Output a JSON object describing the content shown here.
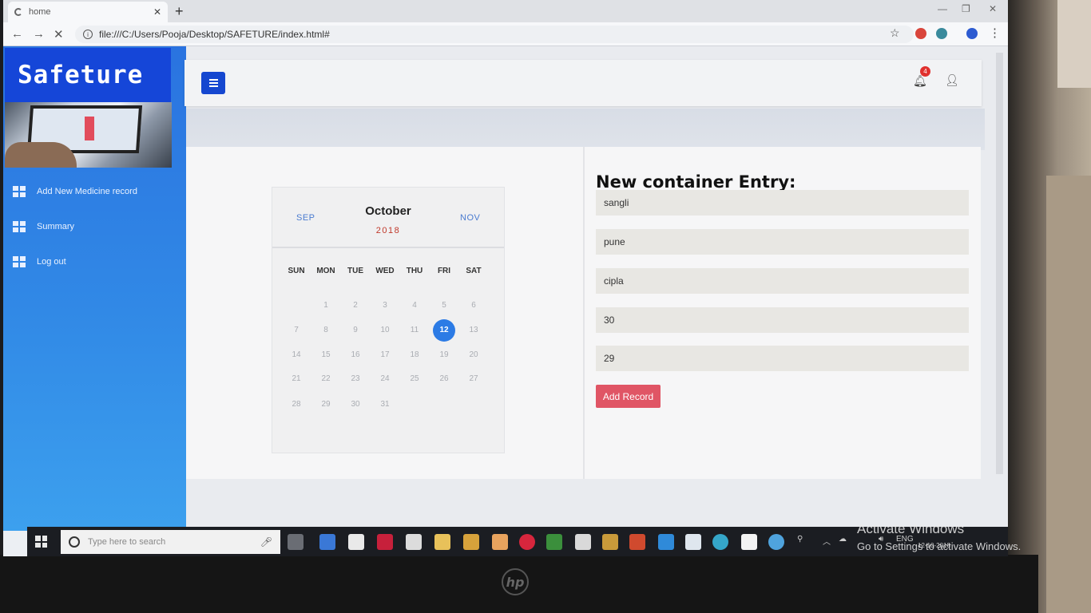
{
  "browser": {
    "tab_title": "home",
    "new_tab": "+",
    "url": "file:///C:/Users/Pooja/Desktop/SAFETURE/index.html#"
  },
  "sidebar": {
    "brand": "Safeture",
    "items": [
      {
        "label": "Add New Medicine record",
        "icon": "grid-icon"
      },
      {
        "label": "Summary",
        "icon": "grid-icon"
      },
      {
        "label": "Log out",
        "icon": "grid-icon"
      }
    ]
  },
  "topbar": {
    "notification_count": "4",
    "icons": [
      "menu-icon",
      "bell-icon",
      "user-icon"
    ]
  },
  "calendar": {
    "prev_month": "SEP",
    "month": "October",
    "year": "2018",
    "next_month": "NOV",
    "weekdays": [
      "SUN",
      "MON",
      "TUE",
      "WED",
      "THU",
      "FRI",
      "SAT"
    ],
    "weeks": [
      [
        "",
        "1",
        "2",
        "3",
        "4",
        "5",
        "6"
      ],
      [
        "7",
        "8",
        "9",
        "10",
        "11",
        "12",
        "13"
      ],
      [
        "14",
        "15",
        "16",
        "17",
        "18",
        "19",
        "20"
      ],
      [
        "21",
        "22",
        "23",
        "24",
        "25",
        "26",
        "27"
      ],
      [
        "28",
        "29",
        "30",
        "31",
        "",
        "",
        ""
      ]
    ],
    "selected_day": "12"
  },
  "form": {
    "title": "New container Entry:",
    "fields": [
      "sangli",
      "pune",
      "cipla",
      "30",
      "29"
    ],
    "submit_label": "Add Record"
  },
  "taskbar": {
    "search_placeholder": "Type here to search",
    "language": "ENG",
    "date": "12-10-2018"
  },
  "watermark": {
    "line1": "Activate Windows",
    "line2": "Go to Settings to activate Windows."
  },
  "colors": {
    "brand_blue": "#1546d8",
    "sidebar_blue": "#2f84e4",
    "button_red": "#e05565",
    "today_blue": "#2c7be5",
    "year_red": "#c0392b"
  }
}
